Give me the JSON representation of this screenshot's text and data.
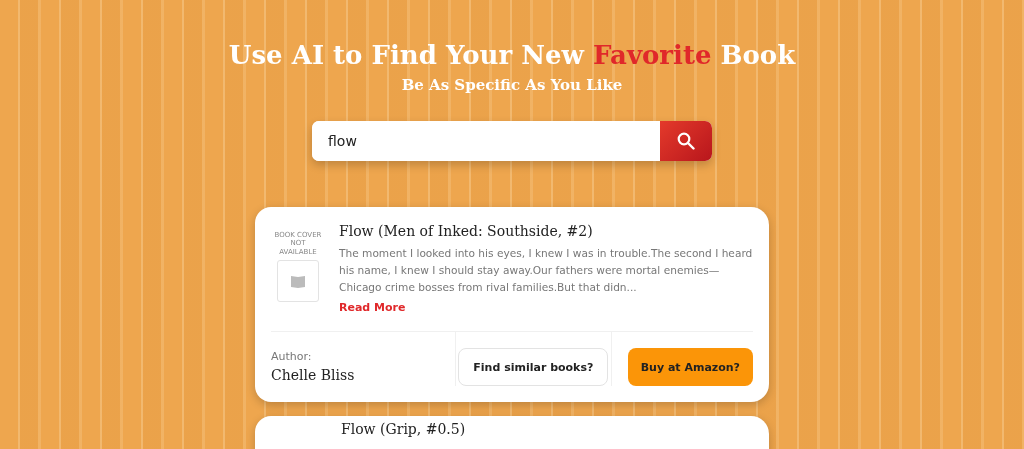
{
  "header": {
    "title": "Use AI to Find Your New **Favorite** Book",
    "subtitle": "Be As Specific As You Like"
  },
  "search": {
    "value": "flow"
  },
  "books": [
    {
      "cover_note": "BOOK COVER NOT AVAILABLE",
      "title": "Flow (Men of Inked: Southside, #2)",
      "description": "The moment I looked into his eyes, I knew I was in trouble.The second I heard his name, I knew I should stay away.Our fathers were mortal enemies—Chicago crime bosses from rival families.But that didn...",
      "read_more": "Read More",
      "author_label": "Author:",
      "author": "Chelle Bliss",
      "similar_button": "Find similar books?",
      "buy_button": "Buy at Amazon?"
    },
    {
      "title": "Flow (Grip, #0.5)"
    }
  ]
}
